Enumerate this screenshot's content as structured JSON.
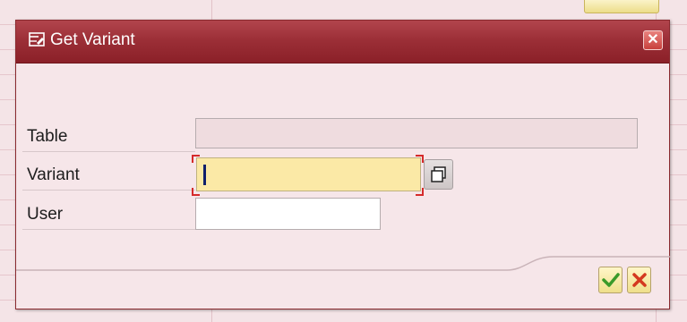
{
  "dialog": {
    "title": "Get Variant",
    "title_icon": "dialog-window-icon",
    "close_icon": "close-icon"
  },
  "form": {
    "fields": [
      {
        "label": "Table",
        "value": "",
        "state": "disabled"
      },
      {
        "label": "Variant",
        "value": "",
        "state": "focused"
      },
      {
        "label": "User",
        "value": "",
        "state": "editable"
      }
    ],
    "value_help_icon": "value-help-icon"
  },
  "footer": {
    "ok_icon": "checkmark-icon",
    "cancel_icon": "cross-icon"
  },
  "colors": {
    "titlebar": "#9c2f37",
    "focused_field": "#fbe9a6",
    "ok_check": "#3a9a2a",
    "cancel_cross": "#d4391f"
  }
}
